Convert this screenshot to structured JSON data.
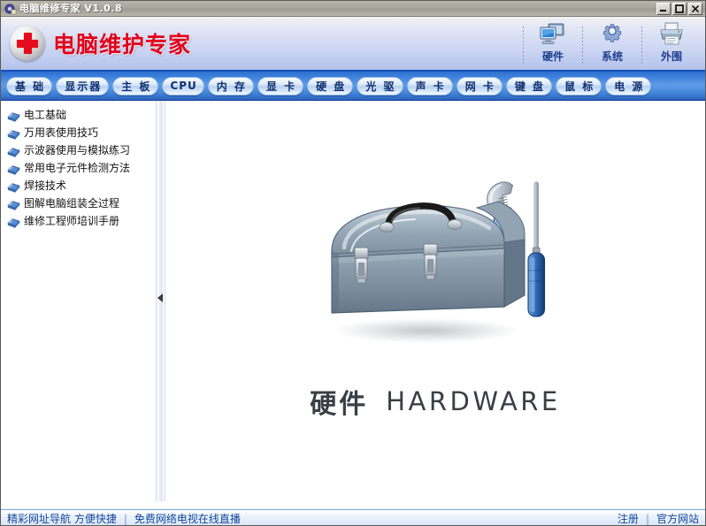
{
  "window": {
    "title": "电脑维修专家 V1.0.8",
    "icon": "app-icon",
    "buttons": {
      "minimize": "minimize",
      "maximize": "maximize",
      "close": "close"
    }
  },
  "header": {
    "logo_icon": "red-cross-icon",
    "brand": "电脑维护专家",
    "tools": [
      {
        "label": "硬件",
        "icon": "monitor-icon"
      },
      {
        "label": "系统",
        "icon": "gear-icon"
      },
      {
        "label": "外围",
        "icon": "printer-icon"
      }
    ]
  },
  "tabs": [
    {
      "label": "基 础",
      "active": true
    },
    {
      "label": "显示器",
      "active": false
    },
    {
      "label": "主 板",
      "active": false
    },
    {
      "label": "CPU",
      "active": false
    },
    {
      "label": "内 存",
      "active": false
    },
    {
      "label": "显 卡",
      "active": false
    },
    {
      "label": "硬 盘",
      "active": false
    },
    {
      "label": "光 驱",
      "active": false
    },
    {
      "label": "声 卡",
      "active": false
    },
    {
      "label": "网 卡",
      "active": false
    },
    {
      "label": "键 盘",
      "active": false
    },
    {
      "label": "鼠 标",
      "active": false
    },
    {
      "label": "电 源",
      "active": false
    }
  ],
  "sidebar": {
    "items": [
      {
        "label": "电工基础",
        "icon": "book-icon"
      },
      {
        "label": "万用表使用技巧",
        "icon": "book-icon"
      },
      {
        "label": "示波器使用与模拟练习",
        "icon": "book-icon"
      },
      {
        "label": "常用电子元件检测方法",
        "icon": "book-icon"
      },
      {
        "label": "焊接技术",
        "icon": "book-icon"
      },
      {
        "label": "图解电脑组装全过程",
        "icon": "book-icon"
      },
      {
        "label": "维修工程师培训手册",
        "icon": "book-icon"
      }
    ]
  },
  "splitter": {
    "collapse_icon": "collapse-left-arrow-icon"
  },
  "content": {
    "illustration": "toolbox-wrench-screwdriver-icon",
    "caption_cn": "硬件",
    "caption_en": "HARDWARE"
  },
  "statusbar": {
    "left_link_1": "精彩网址导航 方便快捷",
    "separator": "|",
    "left_link_2": "免费网络电视在线直播",
    "right_link_1": "注册",
    "right_link_2": "官方网站"
  },
  "colors": {
    "brand_red": "#e2001a",
    "tabbar_blue": "#3d81dc",
    "status_text": "#14479c",
    "caption_gray": "#3a3f45"
  }
}
